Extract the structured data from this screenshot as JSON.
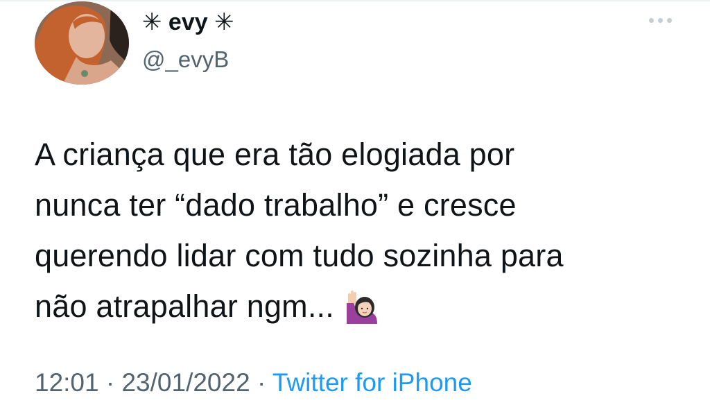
{
  "user": {
    "display_name": "✳︎ evy ✳︎",
    "handle": "@_evyB",
    "avatar_icon": "profile-photo"
  },
  "tweet": {
    "lines": [
      "A criança que era tão elogiada por",
      "nunca ter “dado trabalho” e cresce",
      "querendo lidar com tudo sozinha para",
      "não atrapalhar ngm..."
    ],
    "emoji": "raising-hand-woman-emoji"
  },
  "meta": {
    "time": "12:01",
    "separator1": " · ",
    "date": "23/01/2022",
    "separator2": " · ",
    "source": "Twitter for iPhone"
  },
  "icons": {
    "more": "more-horizontal-icon"
  },
  "colors": {
    "text": "#0f1419",
    "secondary": "#536471",
    "link": "#1d9bf0"
  }
}
